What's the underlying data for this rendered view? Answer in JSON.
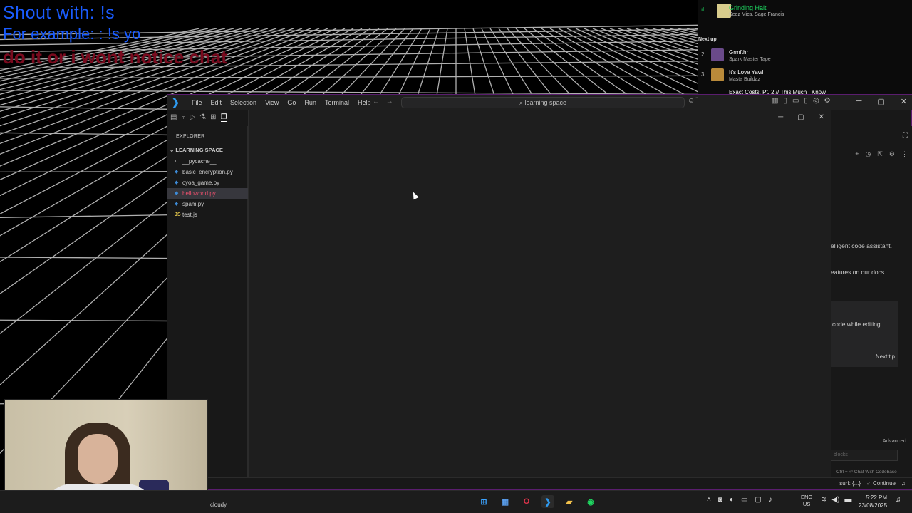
{
  "overlay": {
    "line1": "Shout with: !s",
    "line2": "For example: : !s yo",
    "line3": "do it or i wont notice chat"
  },
  "spotify": {
    "now_playing": {
      "title": "Grinding Halt",
      "artist": "Seez Mics, Sage Francis",
      "art_color": "#d8cc8c"
    },
    "next_up_label": "Next up",
    "queue": [
      {
        "num": "2",
        "title": "Grmfthr",
        "artist": "Spark Master Tape",
        "art_color": "#6a4a8a"
      },
      {
        "num": "3",
        "title": "It's Love Yawl",
        "artist": "Masta Buildaz",
        "art_color": "#b98a3a"
      },
      {
        "num": "",
        "title": "Exact Costs, Pt. 2 // This Much I Know",
        "artist": "",
        "art_color": "#444444"
      }
    ]
  },
  "vscode": {
    "menu": [
      "File",
      "Edit",
      "Selection",
      "View",
      "Go",
      "Run",
      "Terminal",
      "Help"
    ],
    "nav_arrows": "← →",
    "command_center": "learning space",
    "window_controls": {
      "min": "─",
      "max": "▢",
      "close": "✕"
    },
    "explorer": {
      "title": "EXPLORER",
      "folder": "LEARNING SPACE",
      "items": [
        {
          "label": "__pycache__",
          "type": "folder",
          "icon": "chevron-right-icon"
        },
        {
          "label": "basic_encryption.py",
          "type": "py",
          "icon": "python-icon"
        },
        {
          "label": "cyoa_game.py",
          "type": "py",
          "icon": "python-icon"
        },
        {
          "label": "helloworld.py",
          "type": "py",
          "icon": "python-icon",
          "selected": true,
          "error": true
        },
        {
          "label": "spam.py",
          "type": "py",
          "icon": "python-icon"
        },
        {
          "label": "test.js",
          "type": "js",
          "icon": "js-icon"
        }
      ]
    },
    "copilot": {
      "line1": "elligent code assistant.",
      "line2": "eatures on our docs.",
      "tip": "code while editing",
      "next_tip": "Next tip",
      "advanced": "Advanced",
      "input_placeholder": "blocks",
      "hint": "Ctrl + ⏎  Chat With Codebase"
    },
    "status": {
      "surf": "surf: {...}",
      "continue": "✓ Continue",
      "bell": "🔔"
    }
  },
  "taskbar": {
    "weather": "cloudy",
    "lang": {
      "top": "ENG",
      "bottom": "US"
    },
    "time": "5:22 PM",
    "date": "23/08/2025",
    "apps": [
      {
        "name": "windows-start-icon",
        "glyph": "⊞",
        "color": "#3ba3ff",
        "bg": "transparent"
      },
      {
        "name": "calculator-icon",
        "glyph": "▦",
        "color": "#5aa0f0",
        "bg": "transparent"
      },
      {
        "name": "opera-icon",
        "glyph": "O",
        "color": "#e0344b",
        "bg": "transparent"
      },
      {
        "name": "vscode-icon",
        "glyph": "❯",
        "color": "#2f9bf0",
        "bg": "#2b2b2b"
      },
      {
        "name": "file-explorer-icon",
        "glyph": "▰",
        "color": "#f2c14b",
        "bg": "transparent"
      },
      {
        "name": "spotify-icon",
        "glyph": "◉",
        "color": "#1ed760",
        "bg": "transparent"
      }
    ]
  }
}
